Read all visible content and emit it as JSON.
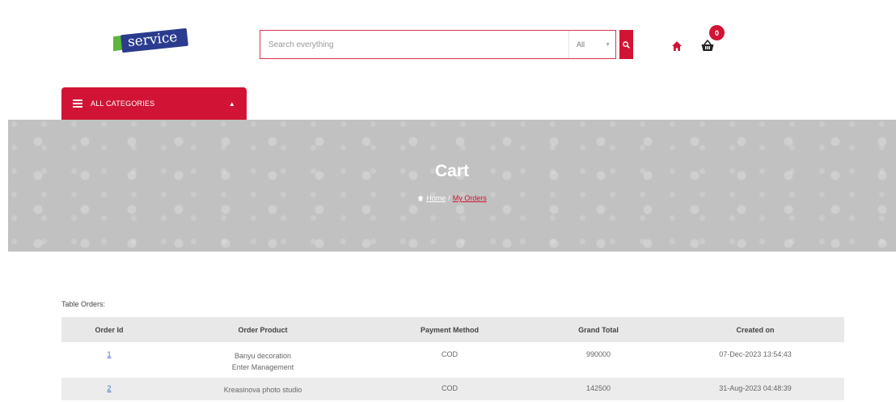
{
  "header": {
    "logo_text": "service",
    "search": {
      "placeholder": "Search everything",
      "category": "All"
    },
    "cart_count": "0"
  },
  "nav": {
    "all_categories_label": "ALL CATEGORIES"
  },
  "banner": {
    "title": "Cart",
    "breadcrumb": {
      "home": "Home",
      "separator": "/",
      "current": "My Orders"
    }
  },
  "orders": {
    "caption": "Table Orders:",
    "columns": [
      "Order Id",
      "Order Product",
      "Payment Method",
      "Grand Total",
      "Created on"
    ],
    "rows": [
      {
        "id": "1",
        "products": [
          "Banyu decoration",
          "Enter Management"
        ],
        "payment": "COD",
        "total": "990000",
        "created": "07-Dec-2023 13:54:43"
      },
      {
        "id": "2",
        "products": [
          "Kreasinova photo studio"
        ],
        "payment": "COD",
        "total": "142500",
        "created": "31-Aug-2023 04:48:39"
      }
    ]
  },
  "colors": {
    "accent": "#d11435",
    "banner_bg": "#c1c1c1",
    "link": "#3b73c4",
    "logo_blue": "#2b3c8f",
    "logo_green": "#5db53b"
  },
  "icons": {
    "search": "search-icon",
    "home": "home-icon",
    "cart": "shopping-basket-icon",
    "menu": "hamburger-icon",
    "chevron": "chevron-up-icon",
    "dropdown": "caret-down-icon"
  }
}
